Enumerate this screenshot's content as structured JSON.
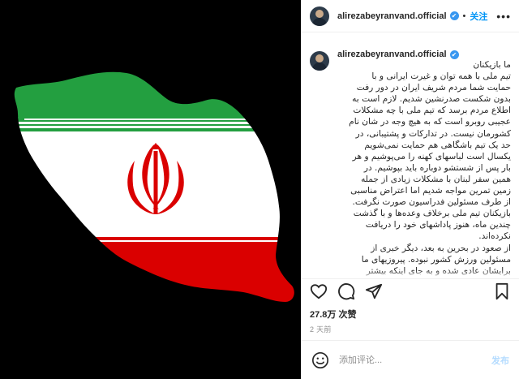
{
  "post": {
    "username": "alirezabeyranvand.official",
    "verified_mark": "✔",
    "separator": "•",
    "follow_label": "关注",
    "more_label": "•••",
    "caption_username": "alirezabeyranvand.official",
    "caption_lines": [
      "ما بازیکنان",
      "تیم ملی با همه توان و غیرت ایرانی و با",
      "حمایت شما مردم شریف ایران در دور رفت",
      "بدون شکست صدرنشین شدیم. لازم است به",
      "اطلاع مردم برسد که تیم ملی با چه مشکلات",
      "عجیبی روبرو است که به هیچ وجه در شان نام",
      "کشورمان نیست. در تدارکات و پشتیبانی، در",
      "حد یک تیم باشگاهی هم حمایت نمی‌شویم",
      "یکسال است لباسهای کهنه را می‌پوشیم و هر",
      "بار پس از شستشو دوباره باید بپوشیم. در",
      "همین سفر لبنان با مشکلات زیادی از جمله",
      "زمین تمرین مواجه شدیم اما اعتراض مناسبی",
      "از طرف مسئولین فدراسیون صورت نگرفت.",
      "بازیکنان تیم ملی برخلاف وعده‌ها و با گذشت",
      "چندین ماه، هنوز پاداشهای خود را دریافت",
      "نکرده‌اند.",
      "از صعود در بحرین به بعد، دیگر خبری از",
      "مسئولین ورزش کشور نبوده. پیروزیهای ما",
      "برایشان عادی شده و به جای اینکه بیشتر",
      "..."
    ],
    "likes_text": "27.8万 次赞",
    "time_text": "2 天前",
    "comment_placeholder": "添加评论...",
    "post_label": "发布"
  },
  "icons": {
    "like": "heart-icon",
    "comment": "comment-icon",
    "share": "paper-plane-icon",
    "save": "bookmark-icon",
    "emoji": "emoji-icon"
  },
  "colors": {
    "flag_green": "#239f40",
    "flag_white": "#ffffff",
    "flag_red": "#da0000",
    "link_blue": "#0095f6",
    "verified_blue": "#3897f0"
  }
}
